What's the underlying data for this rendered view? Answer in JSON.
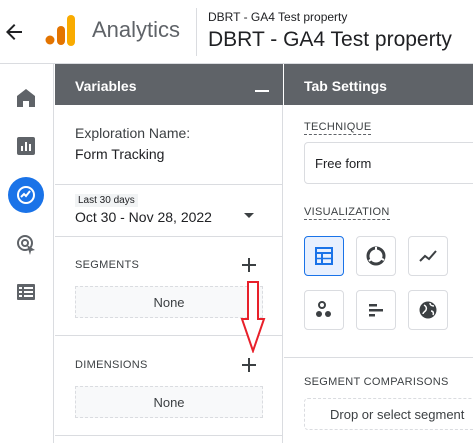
{
  "header": {
    "app_title": "Analytics",
    "property_small": "DBRT - GA4 Test property",
    "property_large": "DBRT - GA4 Test property"
  },
  "variables": {
    "title": "Variables",
    "exploration_label": "Exploration Name:",
    "exploration_value": "Form Tracking",
    "date_range_label": "Last 30 days",
    "date_range_value": "Oct 30 - Nov 28, 2022",
    "segments_label": "SEGMENTS",
    "segments_empty": "None",
    "dimensions_label": "DIMENSIONS",
    "dimensions_empty": "None"
  },
  "tab_settings": {
    "title": "Tab Settings",
    "technique_label": "TECHNIQUE",
    "technique_value": "Free form",
    "visualization_label": "VISUALIZATION",
    "visualizations": [
      "table-icon",
      "donut-chart-icon",
      "line-chart-icon",
      "scatter-plot-icon",
      "bar-chart-icon",
      "geo-map-icon"
    ],
    "selected_visualization": "table-icon",
    "segment_comparisons_label": "SEGMENT COMPARISONS",
    "segment_drop_placeholder": "Drop or select segment"
  },
  "left_nav": [
    "home-icon",
    "reports-icon",
    "explore-icon",
    "advertising-icon",
    "configure-icon"
  ],
  "colors": {
    "accent": "#1a73e8",
    "panel_header": "#5f6368",
    "logo_orange": "#f9ab00",
    "logo_dark_orange": "#e37400",
    "annotation_arrow": "#e8202a"
  }
}
